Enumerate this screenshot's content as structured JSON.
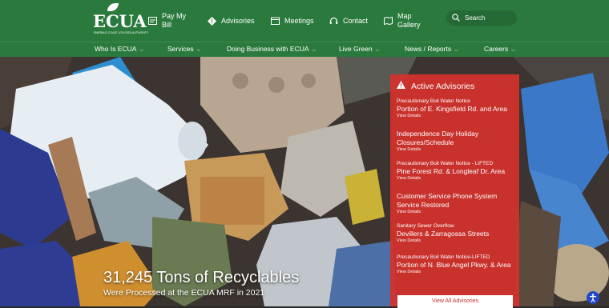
{
  "logo": {
    "word": "ECUA",
    "sub": "EMERALD COAST UTILITIES AUTHORITY"
  },
  "utility": [
    {
      "label": "Pay My Bill",
      "icon": "bill-icon"
    },
    {
      "label": "Advisories",
      "icon": "diamond-alert-icon"
    },
    {
      "label": "Meetings",
      "icon": "calendar-icon"
    },
    {
      "label": "Contact",
      "icon": "headset-icon"
    },
    {
      "label": "Map Gallery",
      "icon": "map-icon"
    }
  ],
  "search": {
    "placeholder": "Search",
    "icon": "search-icon"
  },
  "nav": [
    "Who Is ECUA",
    "Services",
    "Doing Business with ECUA",
    "Live Green",
    "News / Reports",
    "Careers"
  ],
  "hero": {
    "headline": "31,245 Tons of Recyclables",
    "subline": "Were Processed at the ECUA MRF in 2021"
  },
  "advisories": {
    "heading": "Active Advisories",
    "view_details": "View Details",
    "items": [
      {
        "kicker": "Precautionary Boil Water Notice",
        "title": "Portion of E. Kingsfield Rd. and  Area"
      },
      {
        "kicker": "",
        "title": "Independence Day Holiday Closures/Schedule"
      },
      {
        "kicker": "Precautionary Boil Water Notice - LIFTED",
        "title": "Pine Forest Rd. & Longleaf Dr. Area"
      },
      {
        "kicker": "",
        "title": "Customer Service Phone System Service Restored"
      },
      {
        "kicker": "Sanitary Sewer Overflow",
        "title": "Devillers & Zarragossa Streets"
      },
      {
        "kicker": "Precautionary Boil Water Notice-LIFTED",
        "title": "Portion of N. Blue Angel Pkwy. & Area"
      }
    ],
    "view_all": "View All Advisories"
  },
  "colors": {
    "green": "#2b7a3d",
    "red": "#d6312d",
    "accessibility": "#2446c8"
  }
}
